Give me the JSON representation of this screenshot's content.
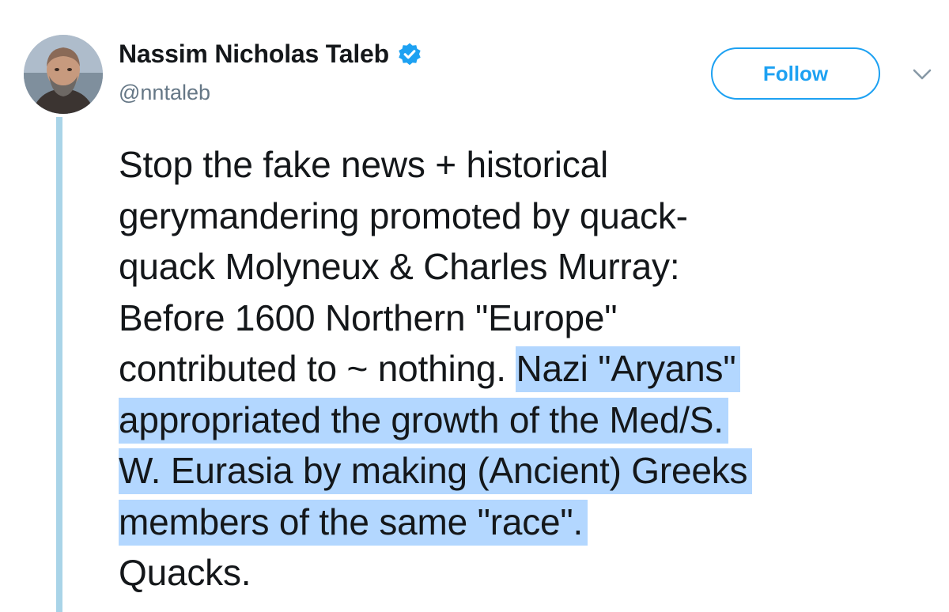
{
  "author": {
    "display_name": "Nassim Nicholas Taleb",
    "handle": "@nntaleb",
    "verified": true,
    "verified_icon": "verified-badge-icon",
    "avatar_icon": "profile-photo"
  },
  "actions": {
    "follow_label": "Follow",
    "more_icon": "chevron-down-icon"
  },
  "tweet": {
    "lines": [
      {
        "plain": "Stop the fake news + historical",
        "highlight": ""
      },
      {
        "plain": "gerymandering promoted by quack-",
        "highlight": ""
      },
      {
        "plain": "quack Molyneux & Charles Murray:",
        "highlight": ""
      },
      {
        "plain": "Before 1600 Northern \"Europe\"",
        "highlight": ""
      },
      {
        "plain": "contributed to ~ nothing. ",
        "highlight": "Nazi \"Aryans\""
      },
      {
        "plain": "",
        "highlight": "appropriated the growth of the Med/S."
      },
      {
        "plain": "",
        "highlight": "W. Eurasia by making (Ancient) Greeks"
      },
      {
        "plain": "",
        "highlight": "members of the same \"race\"."
      },
      {
        "plain": "Quacks.",
        "highlight": ""
      }
    ],
    "selection_color": "#b3d7ff"
  },
  "colors": {
    "accent": "#1da1f2",
    "thread_line": "#a9d4e8",
    "text": "#14171a",
    "secondary_text": "#657786"
  }
}
